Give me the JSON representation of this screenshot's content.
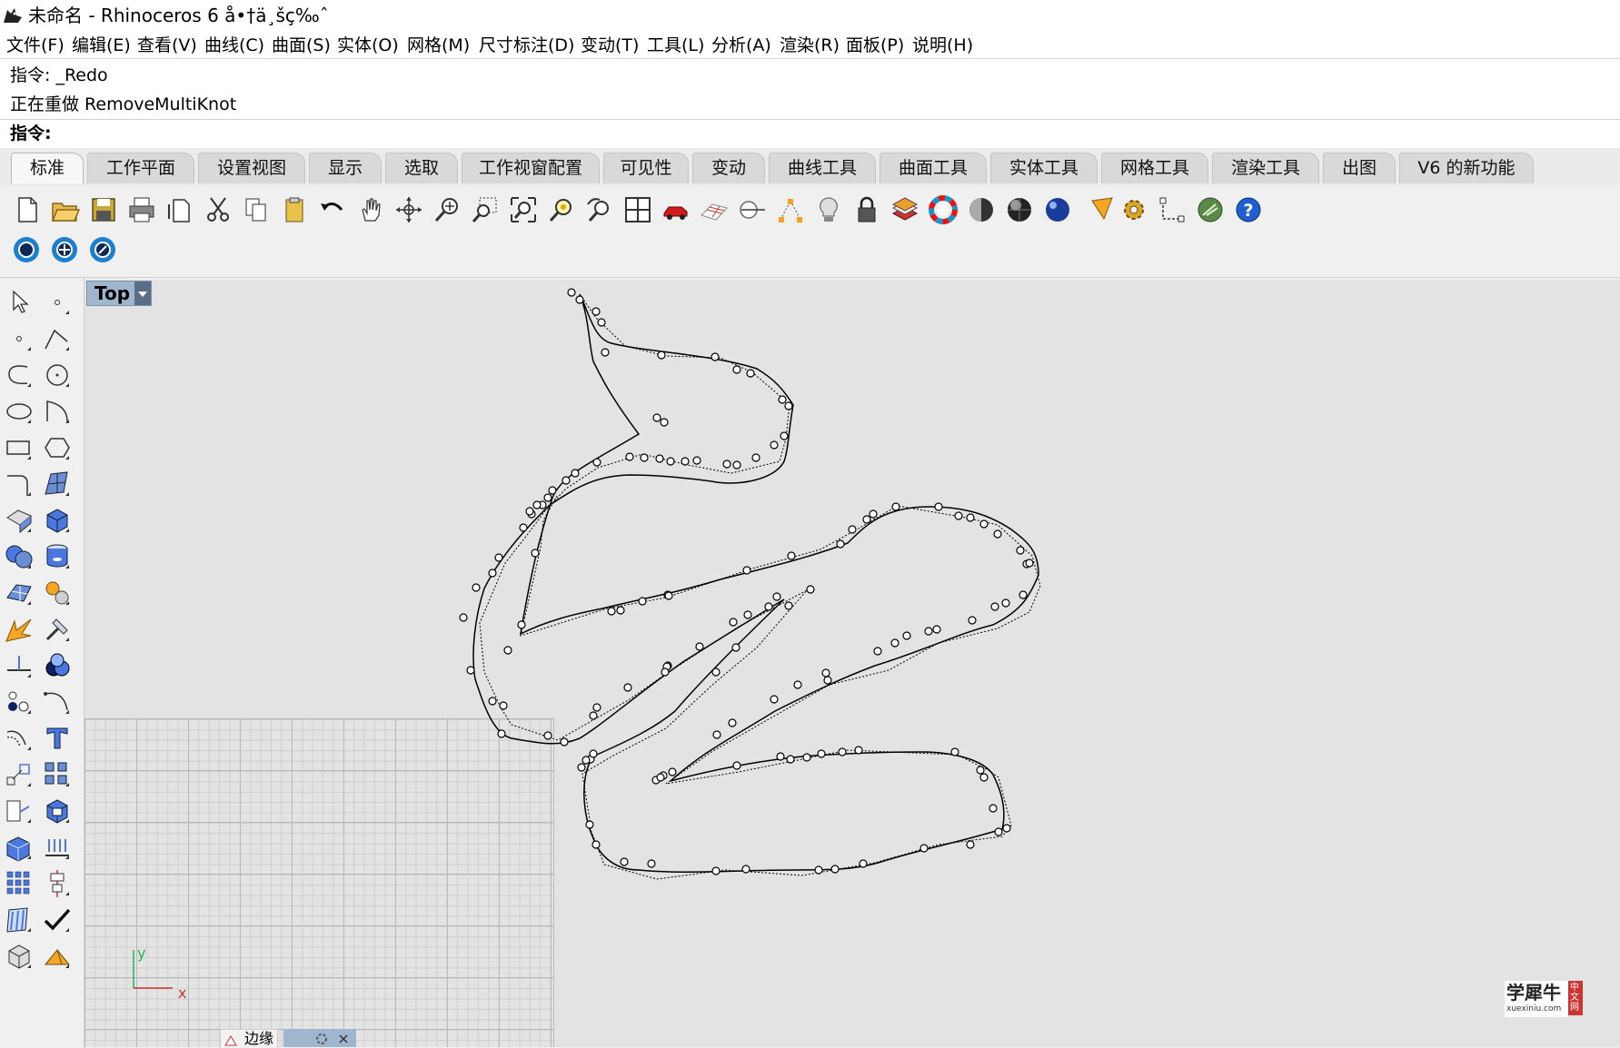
{
  "window": {
    "title": "未命名 - Rhinoceros 6 å•†ä¸šç‰ˆ"
  },
  "menubar": {
    "items": [
      "文件(F)",
      "编辑(E)",
      "查看(V)",
      "曲线(C)",
      "曲面(S)",
      "实体(O)",
      "网格(M)",
      "尺寸标注(D)",
      "变动(T)",
      "工具(L)",
      "分析(A)",
      "渲染(R)",
      "面板(P)",
      "说明(H)"
    ]
  },
  "command": {
    "history1": "指令: _Redo",
    "history2": "正在重做 RemoveMultiKnot",
    "prompt": "指令:"
  },
  "tabs": [
    "标准",
    "工作平面",
    "设置视图",
    "显示",
    "选取",
    "工作视窗配置",
    "可见性",
    "变动",
    "曲线工具",
    "曲面工具",
    "实体工具",
    "网格工具",
    "渲染工具",
    "出图",
    "V6 的新功能"
  ],
  "viewport": {
    "name": "Top",
    "axis_x": "x",
    "axis_y": "y"
  },
  "bottom_panel": {
    "label": "边缘"
  },
  "watermark": {
    "text": "学犀牛",
    "side": "中文网",
    "url": "xuexiniu.com"
  },
  "colors": {
    "viewport_bg": "#e3e3e3",
    "viewport_label_bg": "#9fb6cf",
    "curve": "#000000",
    "axis_x": "#c0392b",
    "axis_y": "#27ae60"
  }
}
